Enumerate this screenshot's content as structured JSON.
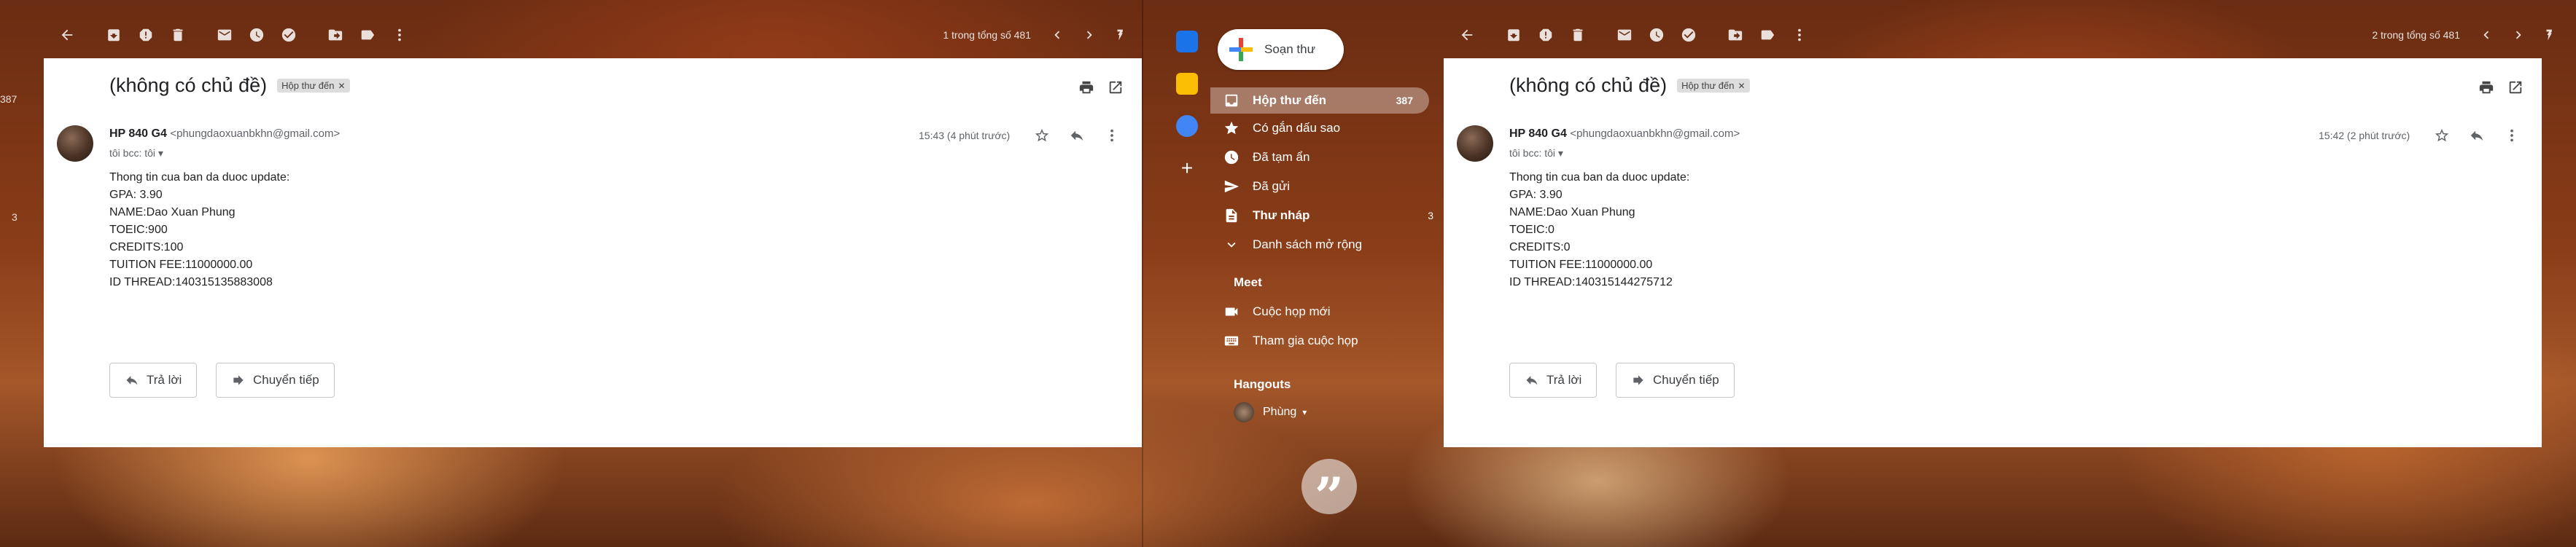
{
  "left_pane": {
    "page_count": "1 trong tổng số 481",
    "edge_badge": "387",
    "edge_num": "3",
    "subject": "(không có chủ đề)",
    "label": "Hộp thư đến",
    "sender_name": "HP 840 G4",
    "sender_email": "<phungdaoxuanbkhn@gmail.com>",
    "to": "tôi bcc: tôi",
    "time": "15:43 (4 phút trước)",
    "body": [
      "Thong tin cua ban da duoc update:",
      "GPA: 3.90",
      "NAME:Dao Xuan Phung",
      "TOEIC:900",
      "CREDITS:100",
      "TUITION FEE:11000000.00",
      "ID THREAD:140315135883008"
    ],
    "reply_label": "Trả lời",
    "forward_label": "Chuyển tiếp"
  },
  "right_pane": {
    "page_count": "2 trong tổng số 481",
    "subject": "(không có chủ đề)",
    "label": "Hộp thư đến",
    "sender_name": "HP 840 G4",
    "sender_email": "<phungdaoxuanbkhn@gmail.com>",
    "to": "tôi bcc: tôi",
    "time": "15:42 (2 phút trước)",
    "body": [
      "Thong tin cua ban da duoc update:",
      "GPA: 3.90",
      "NAME:Dao Xuan Phung",
      "TOEIC:0",
      "CREDITS:0",
      "TUITION FEE:11000000.00",
      "ID THREAD:140315144275712"
    ],
    "reply_label": "Trả lời",
    "forward_label": "Chuyển tiếp"
  },
  "sidebar": {
    "compose_label": "Soạn thư",
    "items": [
      {
        "label": "Hộp thư đến",
        "count": "387",
        "icon": "inbox-icon"
      },
      {
        "label": "Có gắn dấu sao",
        "count": "",
        "icon": "star-icon"
      },
      {
        "label": "Đã tạm ẩn",
        "count": "",
        "icon": "clock-icon"
      },
      {
        "label": "Đã gửi",
        "count": "",
        "icon": "send-icon"
      },
      {
        "label": "Thư nháp",
        "count": "3",
        "icon": "draft-icon"
      },
      {
        "label": "Danh sách mở rộng",
        "count": "",
        "icon": "chevron-down-icon"
      }
    ],
    "meet_title": "Meet",
    "meet_items": [
      {
        "label": "Cuộc họp mới",
        "icon": "video-icon"
      },
      {
        "label": "Tham gia cuộc họp",
        "icon": "keyboard-icon"
      }
    ],
    "hangouts_title": "Hangouts",
    "hangouts_user": "Phùng",
    "hangouts_caret": "▾"
  },
  "colors": {
    "accent_blue": "#1a73e8",
    "compose_red": "#ea4335",
    "compose_yellow": "#fbbc04",
    "compose_green": "#34a853"
  }
}
